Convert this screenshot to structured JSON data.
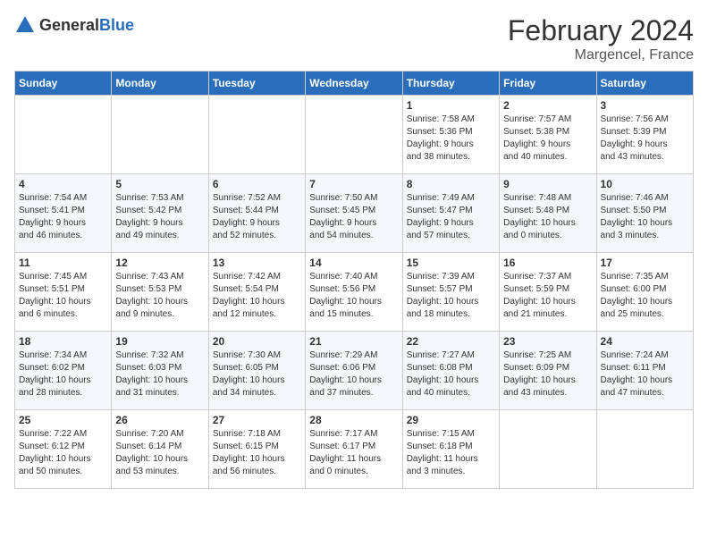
{
  "header": {
    "logo_general": "General",
    "logo_blue": "Blue",
    "title": "February 2024",
    "subtitle": "Margencel, France"
  },
  "days_of_week": [
    "Sunday",
    "Monday",
    "Tuesday",
    "Wednesday",
    "Thursday",
    "Friday",
    "Saturday"
  ],
  "weeks": [
    [
      {
        "day": "",
        "info": ""
      },
      {
        "day": "",
        "info": ""
      },
      {
        "day": "",
        "info": ""
      },
      {
        "day": "",
        "info": ""
      },
      {
        "day": "1",
        "info": "Sunrise: 7:58 AM\nSunset: 5:36 PM\nDaylight: 9 hours\nand 38 minutes."
      },
      {
        "day": "2",
        "info": "Sunrise: 7:57 AM\nSunset: 5:38 PM\nDaylight: 9 hours\nand 40 minutes."
      },
      {
        "day": "3",
        "info": "Sunrise: 7:56 AM\nSunset: 5:39 PM\nDaylight: 9 hours\nand 43 minutes."
      }
    ],
    [
      {
        "day": "4",
        "info": "Sunrise: 7:54 AM\nSunset: 5:41 PM\nDaylight: 9 hours\nand 46 minutes."
      },
      {
        "day": "5",
        "info": "Sunrise: 7:53 AM\nSunset: 5:42 PM\nDaylight: 9 hours\nand 49 minutes."
      },
      {
        "day": "6",
        "info": "Sunrise: 7:52 AM\nSunset: 5:44 PM\nDaylight: 9 hours\nand 52 minutes."
      },
      {
        "day": "7",
        "info": "Sunrise: 7:50 AM\nSunset: 5:45 PM\nDaylight: 9 hours\nand 54 minutes."
      },
      {
        "day": "8",
        "info": "Sunrise: 7:49 AM\nSunset: 5:47 PM\nDaylight: 9 hours\nand 57 minutes."
      },
      {
        "day": "9",
        "info": "Sunrise: 7:48 AM\nSunset: 5:48 PM\nDaylight: 10 hours\nand 0 minutes."
      },
      {
        "day": "10",
        "info": "Sunrise: 7:46 AM\nSunset: 5:50 PM\nDaylight: 10 hours\nand 3 minutes."
      }
    ],
    [
      {
        "day": "11",
        "info": "Sunrise: 7:45 AM\nSunset: 5:51 PM\nDaylight: 10 hours\nand 6 minutes."
      },
      {
        "day": "12",
        "info": "Sunrise: 7:43 AM\nSunset: 5:53 PM\nDaylight: 10 hours\nand 9 minutes."
      },
      {
        "day": "13",
        "info": "Sunrise: 7:42 AM\nSunset: 5:54 PM\nDaylight: 10 hours\nand 12 minutes."
      },
      {
        "day": "14",
        "info": "Sunrise: 7:40 AM\nSunset: 5:56 PM\nDaylight: 10 hours\nand 15 minutes."
      },
      {
        "day": "15",
        "info": "Sunrise: 7:39 AM\nSunset: 5:57 PM\nDaylight: 10 hours\nand 18 minutes."
      },
      {
        "day": "16",
        "info": "Sunrise: 7:37 AM\nSunset: 5:59 PM\nDaylight: 10 hours\nand 21 minutes."
      },
      {
        "day": "17",
        "info": "Sunrise: 7:35 AM\nSunset: 6:00 PM\nDaylight: 10 hours\nand 25 minutes."
      }
    ],
    [
      {
        "day": "18",
        "info": "Sunrise: 7:34 AM\nSunset: 6:02 PM\nDaylight: 10 hours\nand 28 minutes."
      },
      {
        "day": "19",
        "info": "Sunrise: 7:32 AM\nSunset: 6:03 PM\nDaylight: 10 hours\nand 31 minutes."
      },
      {
        "day": "20",
        "info": "Sunrise: 7:30 AM\nSunset: 6:05 PM\nDaylight: 10 hours\nand 34 minutes."
      },
      {
        "day": "21",
        "info": "Sunrise: 7:29 AM\nSunset: 6:06 PM\nDaylight: 10 hours\nand 37 minutes."
      },
      {
        "day": "22",
        "info": "Sunrise: 7:27 AM\nSunset: 6:08 PM\nDaylight: 10 hours\nand 40 minutes."
      },
      {
        "day": "23",
        "info": "Sunrise: 7:25 AM\nSunset: 6:09 PM\nDaylight: 10 hours\nand 43 minutes."
      },
      {
        "day": "24",
        "info": "Sunrise: 7:24 AM\nSunset: 6:11 PM\nDaylight: 10 hours\nand 47 minutes."
      }
    ],
    [
      {
        "day": "25",
        "info": "Sunrise: 7:22 AM\nSunset: 6:12 PM\nDaylight: 10 hours\nand 50 minutes."
      },
      {
        "day": "26",
        "info": "Sunrise: 7:20 AM\nSunset: 6:14 PM\nDaylight: 10 hours\nand 53 minutes."
      },
      {
        "day": "27",
        "info": "Sunrise: 7:18 AM\nSunset: 6:15 PM\nDaylight: 10 hours\nand 56 minutes."
      },
      {
        "day": "28",
        "info": "Sunrise: 7:17 AM\nSunset: 6:17 PM\nDaylight: 11 hours\nand 0 minutes."
      },
      {
        "day": "29",
        "info": "Sunrise: 7:15 AM\nSunset: 6:18 PM\nDaylight: 11 hours\nand 3 minutes."
      },
      {
        "day": "",
        "info": ""
      },
      {
        "day": "",
        "info": ""
      }
    ]
  ]
}
